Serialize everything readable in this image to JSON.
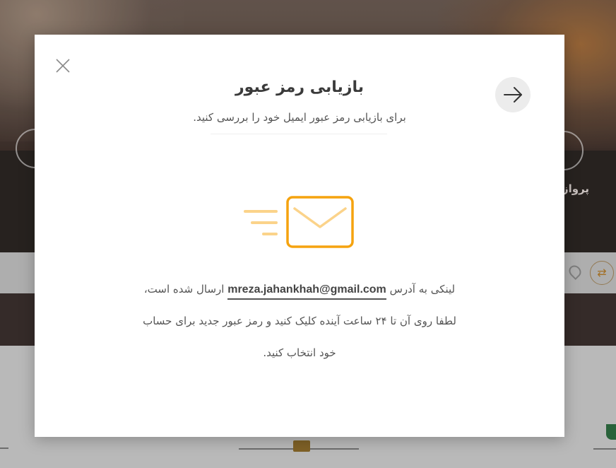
{
  "modal": {
    "title": "بازیابی رمز عبور",
    "subtitle": "برای بازیابی رمز عبور ایمیل خود را بررسی کنید.",
    "message_prefix": "لینکی به آدرس",
    "email": "mreza.jahankhah@gmail.com",
    "message_suffix": "ارسال شده است،",
    "message_line2": "لطفا روی آن تا ۲۴ ساعت آینده کلیک کنید و رمز عبور جدید برای حساب",
    "message_line3": "خود انتخاب کنید.",
    "close_icon": "close-icon",
    "back_icon": "arrow-right-icon",
    "illustration_icon": "envelope-sent-icon"
  },
  "background": {
    "right_label": "پرواز"
  },
  "colors": {
    "accent": "#f5a30f",
    "accent_light": "#fbd38a",
    "title_text": "#3a3a3a",
    "body_text": "#555555",
    "back_button_bg": "#ececec"
  }
}
